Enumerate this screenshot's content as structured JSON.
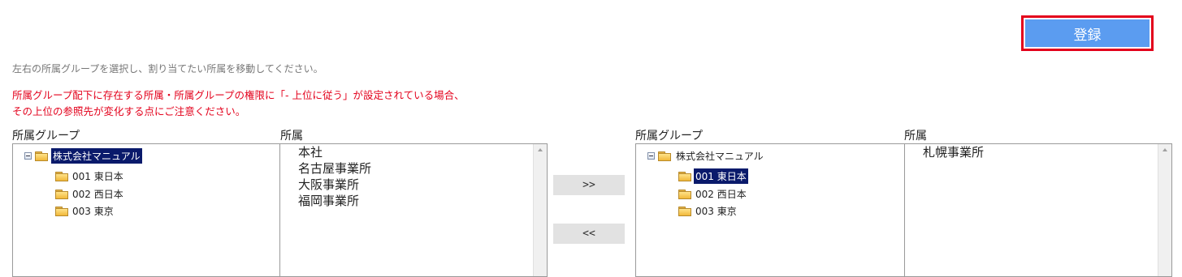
{
  "register_button": {
    "label": "登録"
  },
  "instruction": "左右の所属グループを選択し、割り当てたい所属を移動してください。",
  "warning": {
    "line1": "所属グループ配下に存在する所属・所属グループの権限に「- 上位に従う」が設定されている場合、",
    "line2": "その上位の参照先が変化する点にご注意ください。"
  },
  "left": {
    "group_label": "所属グループ",
    "dept_label": "所属",
    "tree": {
      "root": "株式会社マニュアル",
      "children": [
        "001 東日本",
        "002 西日本",
        "003 東京"
      ]
    },
    "departments": [
      "本社",
      "名古屋事業所",
      "大阪事業所",
      "福岡事業所"
    ]
  },
  "right": {
    "group_label": "所属グループ",
    "dept_label": "所属",
    "tree": {
      "root": "株式会社マニュアル",
      "children": [
        "001 東日本",
        "002 西日本",
        "003 東京"
      ]
    },
    "departments": [
      "札幌事業所"
    ]
  },
  "move": {
    "right_label": ">>",
    "left_label": "<<"
  },
  "colors": {
    "register_bg": "#5b9cf0",
    "highlight": "#e3001b",
    "warning_text": "#e3001b",
    "selected_bg": "#0a1a6b"
  }
}
